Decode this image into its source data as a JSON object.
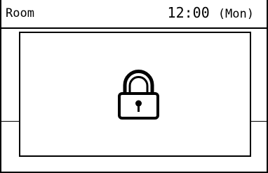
{
  "header": {
    "room_label": "Room",
    "time": "12:00",
    "day": "(Mon)"
  },
  "lock_dialog": {
    "icon": "lock-icon"
  },
  "colors": {
    "background": "#ffffff",
    "foreground": "#000000"
  }
}
